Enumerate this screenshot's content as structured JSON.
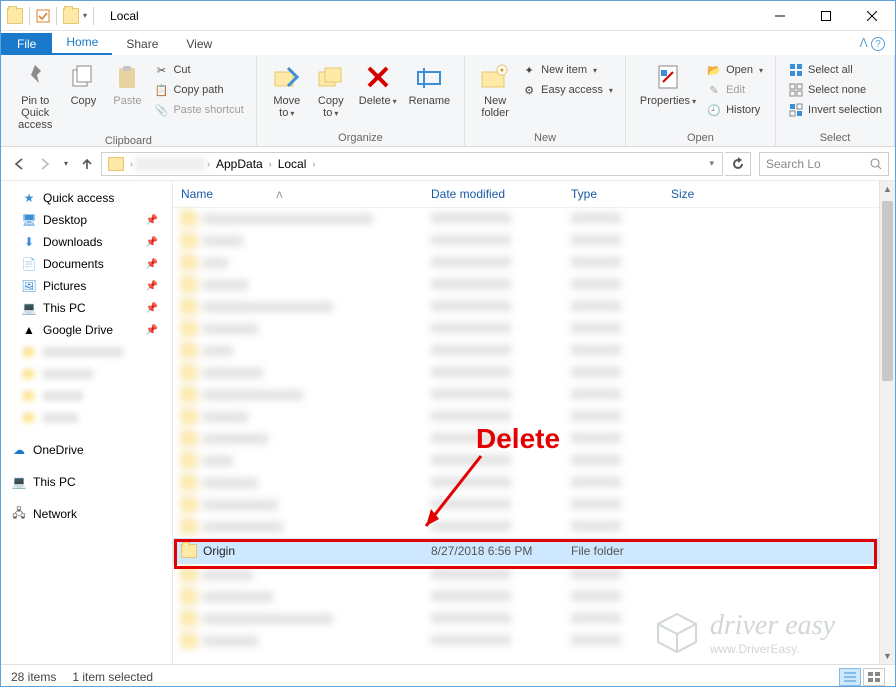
{
  "window": {
    "title": "Local"
  },
  "tabs": {
    "file": "File",
    "home": "Home",
    "share": "Share",
    "view": "View"
  },
  "ribbon": {
    "pin_to_quick": "Pin to Quick\naccess",
    "copy": "Copy",
    "paste": "Paste",
    "cut": "Cut",
    "copy_path": "Copy path",
    "paste_shortcut": "Paste shortcut",
    "clipboard_group": "Clipboard",
    "move_to": "Move\nto",
    "copy_to": "Copy\nto",
    "delete": "Delete",
    "rename": "Rename",
    "organize_group": "Organize",
    "new_folder": "New\nfolder",
    "new_item": "New item",
    "easy_access": "Easy access",
    "new_group": "New",
    "properties": "Properties",
    "open": "Open",
    "edit": "Edit",
    "history": "History",
    "open_group": "Open",
    "select_all": "Select all",
    "select_none": "Select none",
    "invert_selection": "Invert selection",
    "select_group": "Select"
  },
  "breadcrumb": {
    "appdata": "AppData",
    "local": "Local"
  },
  "search": {
    "placeholder": "Search Lo"
  },
  "nav": {
    "quick_access": "Quick access",
    "desktop": "Desktop",
    "downloads": "Downloads",
    "documents": "Documents",
    "pictures": "Pictures",
    "this_pc": "This PC",
    "google_drive": "Google Drive",
    "onedrive": "OneDrive",
    "this_pc2": "This PC",
    "network": "Network"
  },
  "columns": {
    "name": "Name",
    "date": "Date modified",
    "type": "Type",
    "size": "Size"
  },
  "selected_row": {
    "name": "Origin",
    "date": "8/27/2018 6:56 PM",
    "type": "File folder"
  },
  "status": {
    "items": "28 items",
    "selected": "1 item selected"
  },
  "annotation": {
    "label": "Delete"
  },
  "watermark": {
    "brand": "driver easy",
    "url": "www.DriverEasy."
  }
}
